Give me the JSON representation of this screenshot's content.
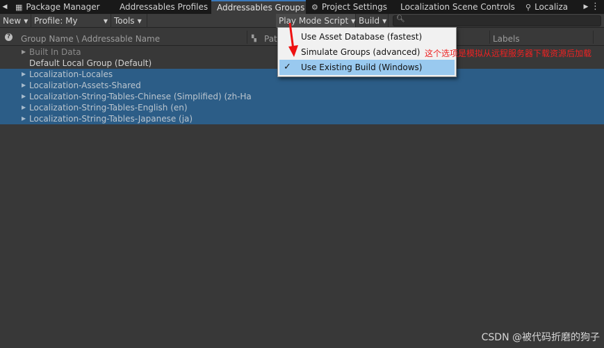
{
  "tabs": {
    "items": [
      {
        "label": "Package Manager",
        "icon": "package-icon"
      },
      {
        "label": "Addressables Profiles",
        "icon": ""
      },
      {
        "label": "Addressables Groups",
        "icon": ""
      },
      {
        "label": "Project Settings",
        "icon": "gear-icon"
      },
      {
        "label": "Localization Scene Controls",
        "icon": ""
      },
      {
        "label": "Localiza",
        "icon": "localization-icon"
      }
    ],
    "active_index": 2
  },
  "toolbar": {
    "new_label": "New",
    "profile_label": "Profile: My",
    "tools_label": "Tools",
    "play_mode_label": "Play Mode Script",
    "build_label": "Build"
  },
  "columns": {
    "name": "Group Name \\ Addressable Name",
    "path": "Pat",
    "labels": "Labels"
  },
  "tree": {
    "rows": [
      {
        "label": "Built In Data",
        "state": "dim",
        "arrow": true
      },
      {
        "label": "Default Local Group (Default)",
        "state": "norm",
        "arrow": false
      },
      {
        "label": "Localization-Locales",
        "state": "sel",
        "arrow": true
      },
      {
        "label": "Localization-Assets-Shared",
        "state": "sel",
        "arrow": true
      },
      {
        "label": "Localization-String-Tables-Chinese (Simplified) (zh-Ha",
        "state": "sel",
        "arrow": true
      },
      {
        "label": "Localization-String-Tables-English (en)",
        "state": "sel",
        "arrow": true
      },
      {
        "label": "Localization-String-Tables-Japanese (ja)",
        "state": "sel",
        "arrow": true
      }
    ]
  },
  "play_mode_menu": {
    "items": [
      {
        "label": "Use Asset Database (fastest)",
        "checked": false
      },
      {
        "label": "Simulate Groups (advanced)",
        "checked": false
      },
      {
        "label": "Use Existing Build (Windows)",
        "checked": true
      }
    ]
  },
  "annotation": {
    "text": "这个选项是模拟从远程服务器下载资源后加载",
    "color": "#ee2222"
  },
  "watermark": "CSDN @被代码折磨的狗子",
  "colors": {
    "selection": "#2c5d87",
    "menu_highlight": "#99c9ef",
    "active_tab_accent": "#3a79bb"
  }
}
